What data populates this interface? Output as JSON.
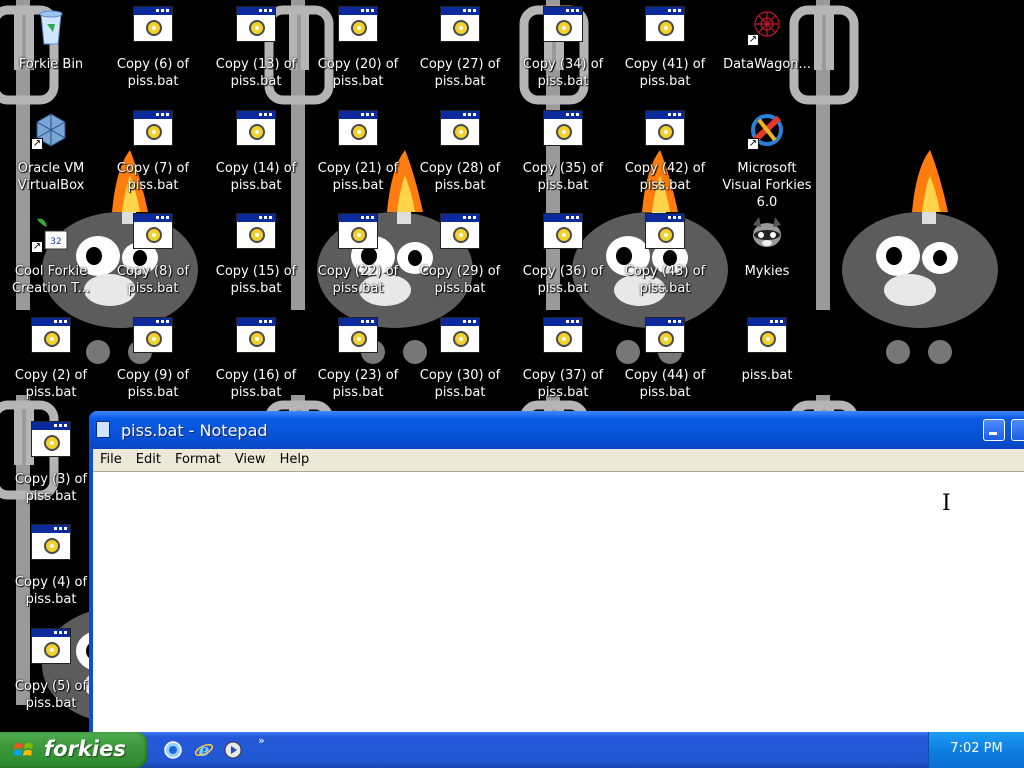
{
  "desktop": {
    "icons": [
      {
        "label": "Forkie Bin",
        "kind": "recycle-bin"
      },
      {
        "label": "Oracle VM VirtualBox",
        "kind": "virtualbox"
      },
      {
        "label": "Cool Forkie Creation T...",
        "kind": "shortcut-app"
      },
      {
        "label": "Copy (2) of piss.bat",
        "kind": "bat"
      },
      {
        "label": "Copy (3) of piss.bat",
        "kind": "bat"
      },
      {
        "label": "Copy (4) of piss.bat",
        "kind": "bat"
      },
      {
        "label": "Copy (5) of piss.bat",
        "kind": "bat"
      },
      {
        "label": "Copy (6) of piss.bat",
        "kind": "bat"
      },
      {
        "label": "Copy (7) of piss.bat",
        "kind": "bat"
      },
      {
        "label": "Copy (8) of piss.bat",
        "kind": "bat"
      },
      {
        "label": "Copy (9) of piss.bat",
        "kind": "bat"
      },
      {
        "label": "Copy (13) of piss.bat",
        "kind": "bat"
      },
      {
        "label": "Copy (14) of piss.bat",
        "kind": "bat"
      },
      {
        "label": "Copy (15) of piss.bat",
        "kind": "bat"
      },
      {
        "label": "Copy (16) of piss.bat",
        "kind": "bat"
      },
      {
        "label": "Copy (20) of piss.bat",
        "kind": "bat"
      },
      {
        "label": "Copy (21) of piss.bat",
        "kind": "bat"
      },
      {
        "label": "Copy (22) of piss.bat",
        "kind": "bat"
      },
      {
        "label": "Copy (23) of piss.bat",
        "kind": "bat"
      },
      {
        "label": "Copy (27) of piss.bat",
        "kind": "bat"
      },
      {
        "label": "Copy (28) of piss.bat",
        "kind": "bat"
      },
      {
        "label": "Copy (29) of piss.bat",
        "kind": "bat"
      },
      {
        "label": "Copy (30) of piss.bat",
        "kind": "bat"
      },
      {
        "label": "Copy (34) of piss.bat",
        "kind": "bat"
      },
      {
        "label": "Copy (35) of piss.bat",
        "kind": "bat"
      },
      {
        "label": "Copy (36) of piss.bat",
        "kind": "bat"
      },
      {
        "label": "Copy (37) of piss.bat",
        "kind": "bat"
      },
      {
        "label": "Copy (41) of piss.bat",
        "kind": "bat"
      },
      {
        "label": "Copy (42) of piss.bat",
        "kind": "bat"
      },
      {
        "label": "Copy (43) of piss.bat",
        "kind": "bat"
      },
      {
        "label": "Copy (44) of piss.bat",
        "kind": "bat"
      },
      {
        "label": "DataWagon...",
        "kind": "datawagon"
      },
      {
        "label": "Microsoft Visual Forkies 6.0",
        "kind": "visual-forkies"
      },
      {
        "label": "Mykies",
        "kind": "raccoon"
      },
      {
        "label": "piss.bat",
        "kind": "bat"
      }
    ]
  },
  "notepad": {
    "title": "piss.bat - Notepad",
    "menu": [
      "File",
      "Edit",
      "Format",
      "View",
      "Help"
    ],
    "content": ""
  },
  "taskbar": {
    "start_label": "forkies",
    "quick_launch": [
      "browser-icon",
      "internet-explorer-icon",
      "media-player-icon"
    ],
    "overflow": "»",
    "clock": "7:02 PM"
  },
  "colors": {
    "taskbar_blue": "#2458d8",
    "start_green": "#3c9a3c",
    "titlebar_blue": "#0a5be8",
    "menubar": "#ece9d8"
  }
}
